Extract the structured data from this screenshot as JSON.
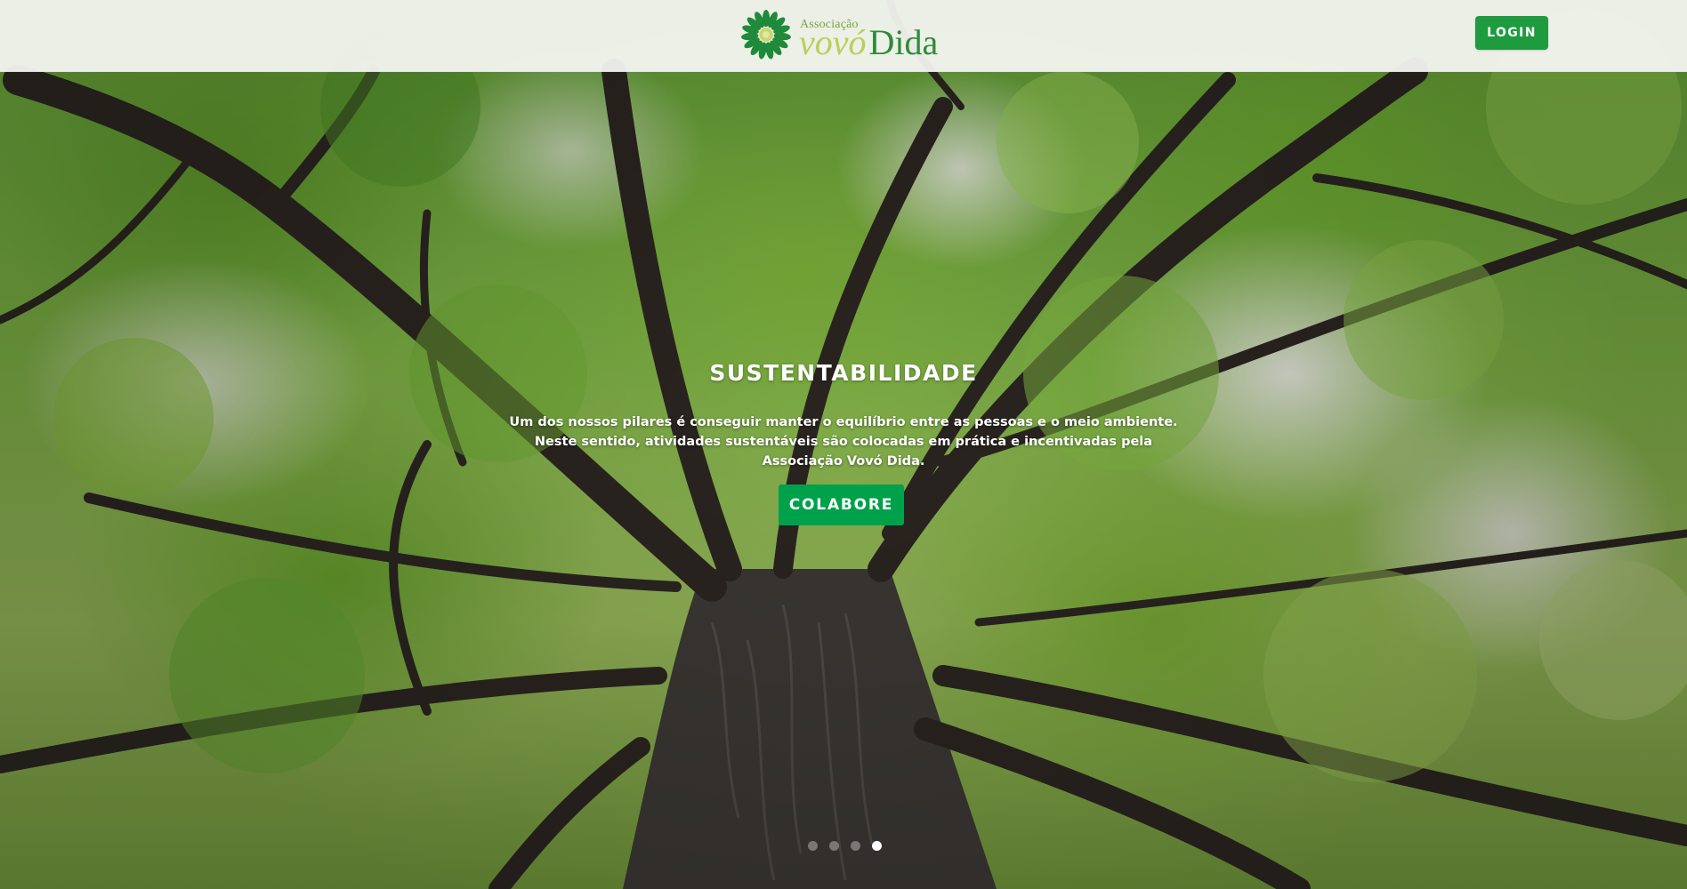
{
  "header": {
    "logo": {
      "small_text": "Associação",
      "word_one": "vovó",
      "word_two": "Dida"
    },
    "login_label": "LOGIN"
  },
  "carousel": {
    "slide_title": "SUSTENTABILIDADE",
    "slide_text": "Um dos nossos pilares é conseguir manter o equilíbrio entre as pessoas e o meio ambiente. Neste sentido, atividades sustentáveis são colocadas em prática e incentivadas pela Associação Vovó Dida.",
    "cta_label": "COLABORE",
    "slide_count": 4,
    "active_index": 3
  },
  "colors": {
    "brand_green": "#1e9b3f",
    "cta_green": "#00a14b",
    "logo_light_green": "#b8cf5c",
    "logo_dark_green": "#2e8b3a"
  }
}
